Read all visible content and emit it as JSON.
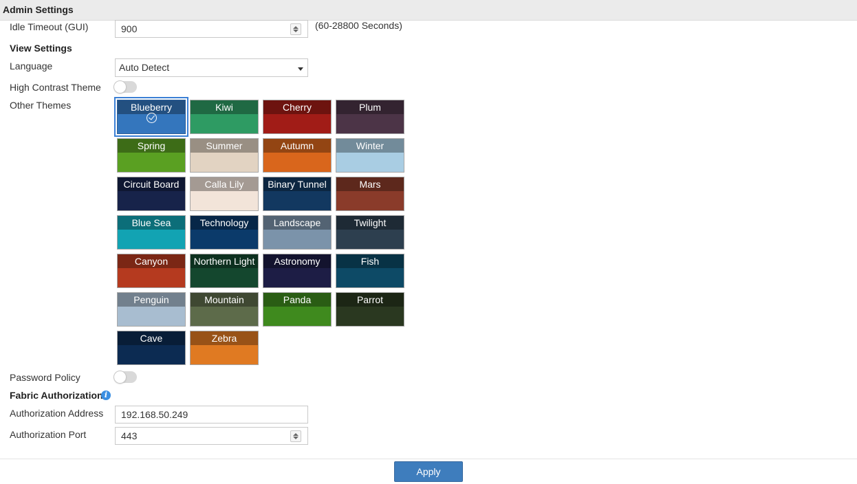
{
  "header": {
    "title": "Admin Settings"
  },
  "idle_timeout": {
    "label": "Idle Timeout (GUI)",
    "value": "900",
    "units": "(60-28800 Seconds)"
  },
  "view_settings": {
    "title": "View Settings",
    "language": {
      "label": "Language",
      "value": "Auto Detect"
    },
    "high_contrast": {
      "label": "High Contrast Theme",
      "enabled": false
    },
    "themes": {
      "label": "Other Themes",
      "selected": "Blueberry",
      "items": [
        {
          "name": "Blueberry",
          "color": "#3476bd"
        },
        {
          "name": "Kiwi",
          "color": "#2e9b63"
        },
        {
          "name": "Cherry",
          "color": "#a11c17"
        },
        {
          "name": "Plum",
          "color": "#4c3447"
        },
        {
          "name": "Spring",
          "color": "#5aa022"
        },
        {
          "name": "Summer",
          "color": "#e2d3c2"
        },
        {
          "name": "Autumn",
          "color": "#d9661c"
        },
        {
          "name": "Winter",
          "color": "#a9cde3"
        },
        {
          "name": "Circuit Board",
          "color": "#17234a"
        },
        {
          "name": "Calla Lily",
          "color": "#f2e4d9"
        },
        {
          "name": "Binary Tunnel",
          "color": "#123860"
        },
        {
          "name": "Mars",
          "color": "#8a3b2a"
        },
        {
          "name": "Blue Sea",
          "color": "#12a3b3"
        },
        {
          "name": "Technology",
          "color": "#0b3a6a"
        },
        {
          "name": "Landscape",
          "color": "#7b93aa"
        },
        {
          "name": "Twilight",
          "color": "#2d3f4f"
        },
        {
          "name": "Canyon",
          "color": "#b53a1f"
        },
        {
          "name": "Northern Light",
          "color": "#14472e"
        },
        {
          "name": "Astronomy",
          "color": "#1d1d45"
        },
        {
          "name": "Fish",
          "color": "#0d4a66"
        },
        {
          "name": "Penguin",
          "color": "#a8bdd0"
        },
        {
          "name": "Mountain",
          "color": "#5d6b4a"
        },
        {
          "name": "Panda",
          "color": "#3f8a1e"
        },
        {
          "name": "Parrot",
          "color": "#2a3820"
        },
        {
          "name": "Cave",
          "color": "#0c2b52"
        },
        {
          "name": "Zebra",
          "color": "#e07a22"
        }
      ]
    }
  },
  "password_policy": {
    "label": "Password Policy",
    "enabled": false
  },
  "fabric_authorization": {
    "title": "Fabric Authorization",
    "info_icon": "info-icon",
    "address": {
      "label": "Authorization Address",
      "value": "192.168.50.249"
    },
    "port": {
      "label": "Authorization Port",
      "value": "443"
    }
  },
  "apply_label": "Apply",
  "colors": {
    "accent": "#3e7dbd",
    "header_bg": "#ebebeb"
  }
}
